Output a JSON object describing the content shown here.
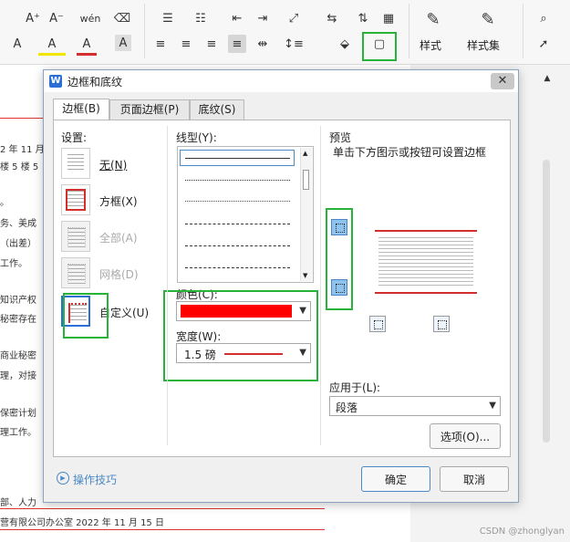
{
  "ribbon": {
    "style_label": "样式",
    "style_set_label": "样式集",
    "buttons": {
      "grow_font": "A⁺",
      "shrink_font": "A⁻",
      "phonetic": "wén",
      "clear_format": "⌫",
      "text_effect": "A",
      "highlight": "A",
      "font_color": "A",
      "char_shading": "A"
    }
  },
  "document": {
    "lines": [
      "2 年 11 月",
      "楼 5 楼 5",
      "。",
      "务、美成",
      "（出差）",
      "工作。",
      "知识产权",
      "秘密存在",
      "商业秘密",
      "理，对接",
      "保密计划",
      "理工作。",
      "部、人力",
      "营有限公司办公室     2022 年 11 月 15 日"
    ]
  },
  "watermark": "CSDN @zhonglyan",
  "dialog": {
    "app_icon": "W",
    "title": "边框和底纹",
    "close": "✕",
    "tabs": [
      "边框(B)",
      "页面边框(P)",
      "底纹(S)"
    ],
    "settings_label": "设置:",
    "settings": [
      {
        "label": "无(N)",
        "enabled": true
      },
      {
        "label": "方框(X)",
        "enabled": true
      },
      {
        "label": "全部(A)",
        "enabled": false
      },
      {
        "label": "网格(D)",
        "enabled": false
      },
      {
        "label": "自定义(U)",
        "enabled": true
      }
    ],
    "line_style_label": "线型(Y):",
    "color_label": "颜色(C):",
    "color_value": "#ff0000",
    "width_label": "宽度(W):",
    "width_value": "1.5  磅",
    "preview_label": "预览",
    "preview_hint": "单击下方图示或按钮可设置边框",
    "apply_label": "应用于(L):",
    "apply_value": "段落",
    "options_button": "选项(O)...",
    "tips_link": "操作技巧",
    "ok_button": "确定",
    "cancel_button": "取消"
  },
  "colors": {
    "highlight_green": "#27b33a",
    "border_red": "#d32f2f",
    "accent_blue": "#2b6fd6"
  }
}
